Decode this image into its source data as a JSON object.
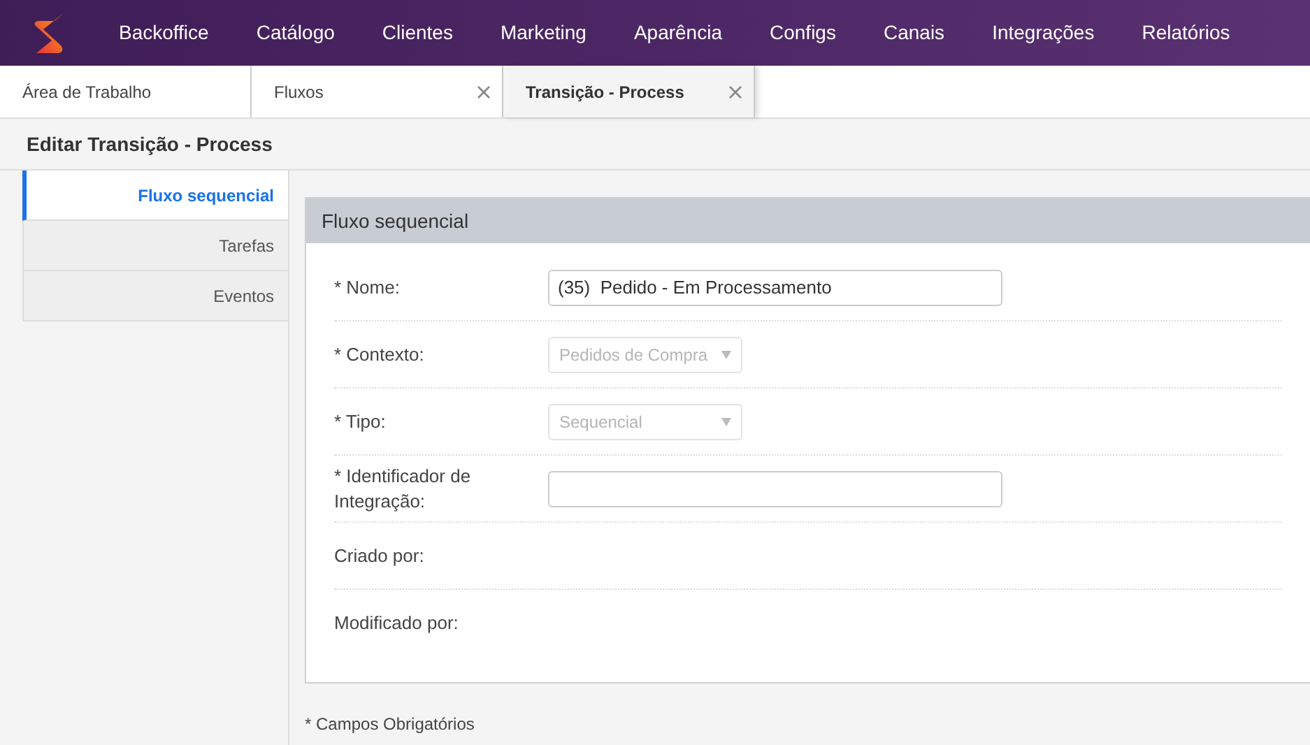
{
  "nav": {
    "items": [
      "Backoffice",
      "Catálogo",
      "Clientes",
      "Marketing",
      "Aparência",
      "Configs",
      "Canais",
      "Integrações",
      "Relatórios"
    ]
  },
  "tabs": [
    {
      "label": "Área de Trabalho",
      "selected": false,
      "closable": false
    },
    {
      "label": "Fluxos",
      "selected": false,
      "closable": true
    },
    {
      "label": "Transição - Process",
      "selected": true,
      "closable": true
    }
  ],
  "page_title": "Editar Transição - Process",
  "side_menu": [
    {
      "label": "Fluxo sequencial",
      "selected": true
    },
    {
      "label": "Tarefas",
      "selected": false
    },
    {
      "label": "Eventos",
      "selected": false
    }
  ],
  "panel": {
    "title": "Fluxo sequencial",
    "fields": [
      {
        "kind": "text",
        "label": "* Nome:",
        "value": "(35)  Pedido - Em Processamento"
      },
      {
        "kind": "select",
        "label": "* Contexto:",
        "value": "Pedidos de Compra",
        "disabled": true
      },
      {
        "kind": "select",
        "label": "* Tipo:",
        "value": "Sequencial",
        "disabled": true
      },
      {
        "kind": "text",
        "label": "* Identificador de Integração:"
      },
      {
        "kind": "empty",
        "label": "Criado por:"
      },
      {
        "kind": "empty",
        "label": "Modificado por:"
      }
    ]
  },
  "footnote": "* Campos Obrigatórios"
}
